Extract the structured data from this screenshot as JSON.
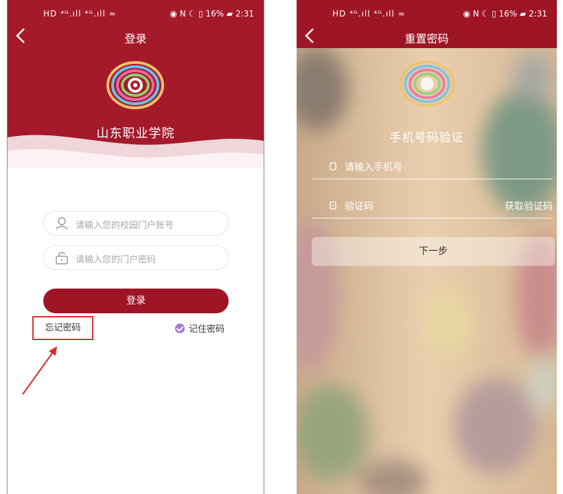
{
  "brand": {
    "primary": "#9e1526",
    "highlight": "#e03030"
  },
  "status_bar": {
    "left": "HD ⁴ᴳ.ıll ⁴ᴳ.ıll ≈",
    "right": "◉ N ☾ ▯ 16% ▰ 2:31"
  },
  "login_screen": {
    "title": "登录",
    "college_name": "山东职业学院",
    "account_placeholder": "请输入您的校园门户账号",
    "password_placeholder": "请输入您的门户密码",
    "login_button": "登录",
    "forgot_password": "忘记密码",
    "remember_password": "记住密码"
  },
  "reset_screen": {
    "title": "重置密码",
    "heading": "手机号码验证",
    "phone_placeholder": "请输入手机号",
    "code_placeholder": "验证码",
    "get_code": "获取验证码",
    "next_button": "下一步"
  },
  "icons": [
    "back-icon",
    "user-icon",
    "lock-icon",
    "phone-icon",
    "code-icon",
    "check-icon",
    "annotation-arrow"
  ]
}
